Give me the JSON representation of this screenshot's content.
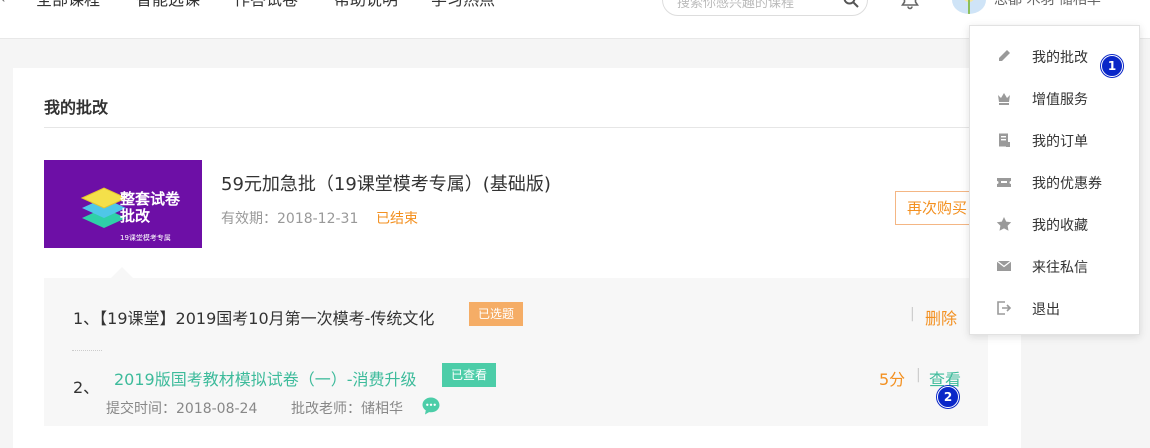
{
  "nav": {
    "items": [
      "全部课程",
      "智能选课",
      "作答试卷",
      "帮助说明",
      "学习热点"
    ],
    "search_placeholder": "搜索你感兴趣的课程",
    "user_name": "思都·木羽·储相华"
  },
  "card": {
    "title": "我的批改",
    "product": {
      "image_title": "整套试卷\n批改",
      "image_subtitle": "19课堂模考专属",
      "title": "59元加急批（19课堂模考专属）(基础版)",
      "valid_label": "有效期：2018-12-31",
      "status": "已结束",
      "rebuy_label": "再次购买"
    },
    "exams": [
      {
        "text": "1、【19课堂】2019国考10月第一次模考-传统文化",
        "badge": "已选题",
        "action": "删除"
      },
      {
        "num": "2、",
        "title": "2019版国考教材模拟试卷（一）-消费升级",
        "badge": "已查看",
        "score": "5分",
        "action": "查看",
        "submit_time": "提交时间：2018-08-24",
        "teacher": "批改老师：储相华"
      }
    ]
  },
  "menu": {
    "items": [
      {
        "label": "我的批改",
        "icon": "pencil-icon"
      },
      {
        "label": "增值服务",
        "icon": "crown-icon"
      },
      {
        "label": "我的订单",
        "icon": "order-icon"
      },
      {
        "label": "我的优惠券",
        "icon": "coupon-icon"
      },
      {
        "label": "我的收藏",
        "icon": "star-icon"
      },
      {
        "label": "来往私信",
        "icon": "mail-icon"
      },
      {
        "label": "退出",
        "icon": "logout-icon"
      }
    ]
  },
  "markers": [
    "1",
    "2"
  ],
  "colors": {
    "accent_orange": "#f39020",
    "accent_green": "#3dbb9b",
    "marker_blue": "#0a27c8",
    "product_purple": "#6d0fa6"
  }
}
